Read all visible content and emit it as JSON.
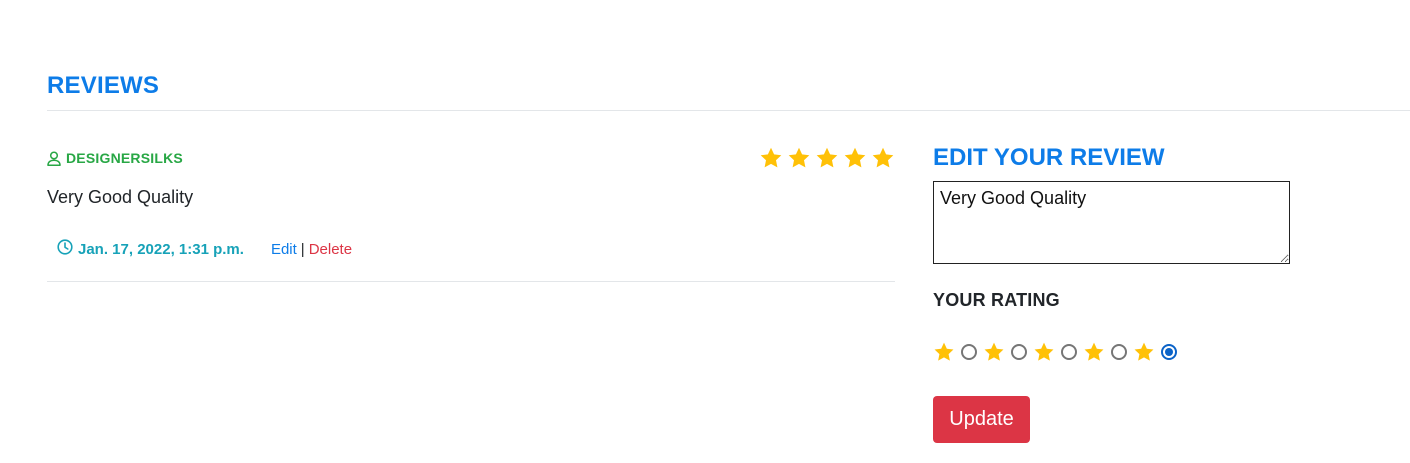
{
  "reviews_section": {
    "title": "REVIEWS"
  },
  "review": {
    "author": "DESIGNERSILKS",
    "rating": 5,
    "rating_max": 5,
    "text": "Very Good Quality",
    "date": "Jan. 17, 2022, 1:31 p.m.",
    "edit_label": "Edit",
    "separator": "|",
    "delete_label": "Delete"
  },
  "edit_panel": {
    "title": "EDIT YOUR REVIEW",
    "textarea_value": "Very Good Quality",
    "rating_label": "YOUR RATING",
    "selected_rating": 5,
    "update_label": "Update"
  },
  "colors": {
    "accent_blue": "#0d7ce8",
    "author_green": "#28a745",
    "date_teal": "#17a2b8",
    "danger_red": "#dc3545",
    "star_gold": "#ffc107"
  },
  "icons": {
    "author": "user-icon",
    "date": "clock-icon",
    "rating": "star-icon"
  }
}
